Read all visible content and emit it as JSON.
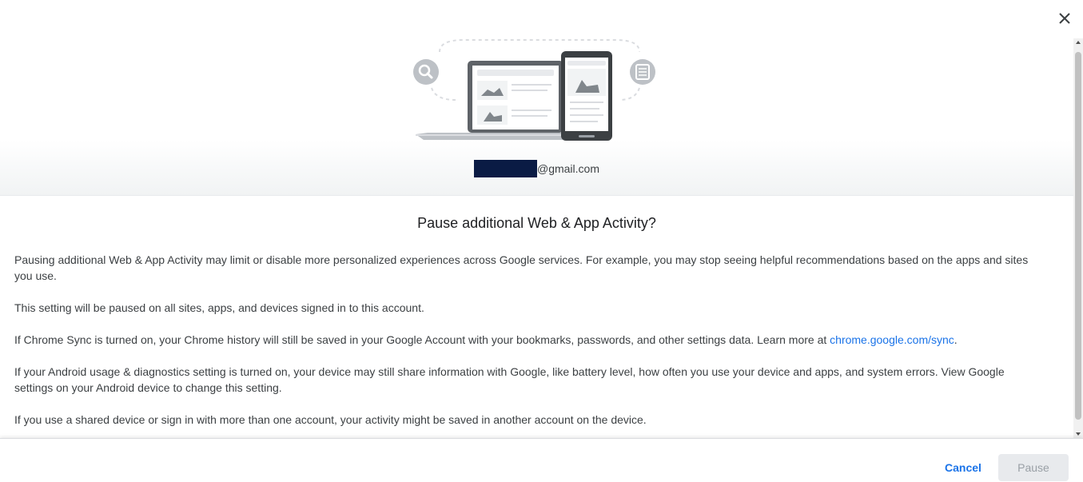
{
  "dialog": {
    "close_icon": "close-icon",
    "email_suffix": "@gmail.com",
    "title": "Pause additional Web & App Activity?",
    "paragraphs": {
      "p1": "Pausing additional Web & App Activity may limit or disable more personalized experiences across Google services. For example, you may stop seeing helpful recommendations based on the apps and sites you use.",
      "p2": "This setting will be paused on all sites, apps, and devices signed in to this account.",
      "p3_prefix": "If Chrome Sync is turned on, your Chrome history will still be saved in your Google Account with your bookmarks, passwords, and other settings data. Learn more at ",
      "p3_link": "chrome.google.com/sync",
      "p3_suffix": ".",
      "p4": "If your Android usage & diagnostics setting is turned on, your device may still share information with Google, like battery level, how often you use your device and apps, and system errors. View Google settings on your Android device to change this setting.",
      "p5": "If you use a shared device or sign in with more than one account, your activity might be saved in another account on the device."
    },
    "buttons": {
      "cancel": "Cancel",
      "pause": "Pause"
    }
  },
  "colors": {
    "link": "#1a73e8",
    "redaction": "#0a1b44",
    "disabled_button_bg": "#e8eaed"
  }
}
